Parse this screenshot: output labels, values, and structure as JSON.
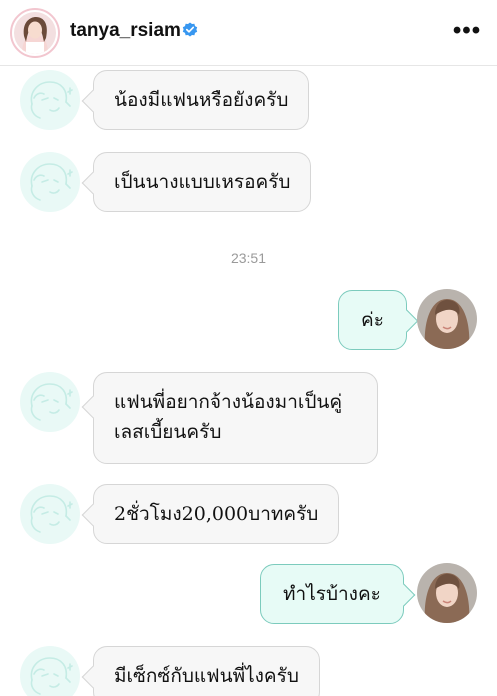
{
  "header": {
    "username": "tanya_rsiam",
    "verified_icon": "verified-badge-icon",
    "more_label": "•••"
  },
  "chat": {
    "messages": [
      {
        "from": "other",
        "text": "น้องมีแฟนหรือยังครับ"
      },
      {
        "from": "other",
        "text": "เป็นนางแบบเหรอครับ"
      },
      {
        "from": "other",
        "text": "แฟนพี่อยากจ้างน้องมาเป็นคู่เลสเบี้ยนครับ"
      },
      {
        "from": "other",
        "text": "2ชั่วโมง20,000บาทครับ"
      },
      {
        "from": "other",
        "text": "มีเซ็กซ์กับแฟนพี่ไงครับ"
      }
    ],
    "replies": [
      {
        "from": "me",
        "text": "ค่ะ"
      },
      {
        "from": "me",
        "text": "ทำไรบ้างคะ"
      }
    ],
    "timestamp": "23:51"
  },
  "colors": {
    "incoming_bubble": "#f7f7f7",
    "outgoing_bubble": "#e7fbf6",
    "outgoing_border": "#7ccbbd",
    "bot_avatar_bg": "#e9f9f6",
    "verified": "#3897f0"
  }
}
